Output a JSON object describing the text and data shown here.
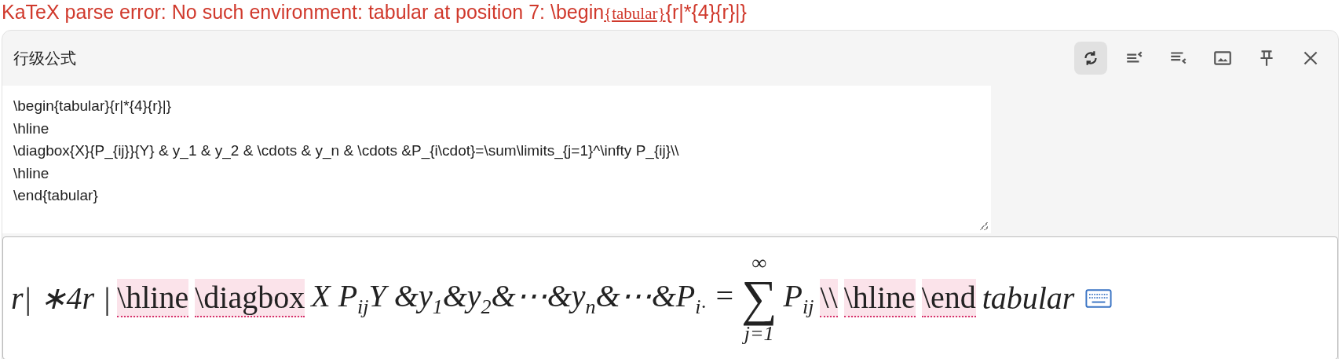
{
  "error": {
    "prefix": "KaTeX parse error: No such environment: tabular at position 7: \\begin",
    "highlight": "{tabular}",
    "suffix": "{r|*{4}{r}|}"
  },
  "panel": {
    "title": "行级公式",
    "toolbar": [
      {
        "kind": "refresh",
        "active": true
      },
      {
        "kind": "align-right",
        "active": false
      },
      {
        "kind": "align-left",
        "active": false
      },
      {
        "kind": "image",
        "active": false
      },
      {
        "kind": "pin",
        "active": false
      },
      {
        "kind": "close",
        "active": false
      }
    ],
    "source_lines": [
      "\\begin{tabular}{r|*{4}{r}|}",
      "\\hline",
      "\\diagbox{X}{P_{ij}}{Y} & y_1 & y_2 & \\cdots & y_n & \\cdots &P_{i\\cdot}=\\sum\\limits_{j=1}^\\infty P_{ij}\\\\",
      "\\hline",
      "\\end{tabular}"
    ],
    "preview": [
      {
        "kind": "math",
        "text": "r| ∗4r |"
      },
      {
        "kind": "error",
        "text": "\\hline"
      },
      {
        "kind": "error",
        "text": "\\diagbox"
      },
      {
        "kind": "math",
        "text": "X P$_{ij}$Y &y$_{1}$&y$_{2}$&⋯&y$_{n}$&⋯&P$_{i·}$ ="
      },
      {
        "kind": "sum",
        "symbol": "∑",
        "upper": "∞",
        "lower": "j=1"
      },
      {
        "kind": "math",
        "text": "P$_{ij}$"
      },
      {
        "kind": "error",
        "text": "\\\\"
      },
      {
        "kind": "error",
        "text": "\\hline"
      },
      {
        "kind": "error",
        "text": "\\end"
      },
      {
        "kind": "math",
        "text": "tabular"
      }
    ]
  }
}
